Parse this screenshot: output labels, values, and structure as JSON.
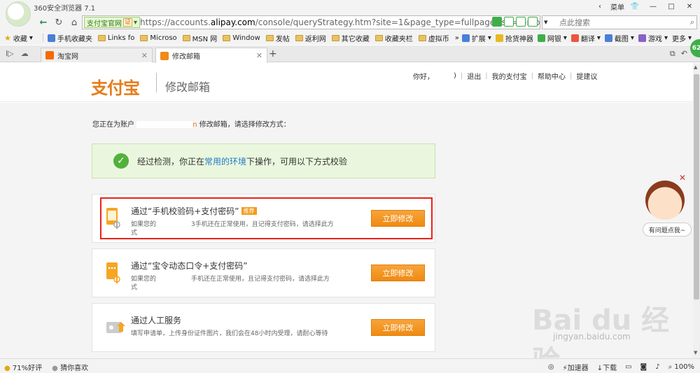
{
  "titlebar": {
    "app_title": "360安全浏览器 7.1",
    "menu_label": "菜单",
    "controls": [
      "‹",
      "菜单",
      "—",
      "□",
      "✕"
    ]
  },
  "addressbar": {
    "cert_label": "支付宝官网",
    "cert_mark": "证",
    "url_prefix": "https://accounts.",
    "url_domain": "alipay.com",
    "url_rest": "/console/queryStrategy.htm?site=1&page_type=fullpage&sp=1-mo",
    "search_placeholder": "点此搜索"
  },
  "bookmarks": {
    "left": [
      "收藏",
      "手机收藏夹",
      "Links fo",
      "Microso",
      "MSN 网",
      "Window",
      "发帖",
      "返利网",
      "其它收藏",
      "收藏夹栏",
      "虚拟币"
    ],
    "right": [
      "扩展",
      "抢货神器",
      "网银",
      "翻译",
      "截图",
      "游戏",
      "更多"
    ]
  },
  "tabs": [
    {
      "label": "淘宝网",
      "active": false
    },
    {
      "label": "修改邮箱",
      "active": true
    }
  ],
  "green_bubble": "62",
  "header": {
    "logo_text": "支付宝",
    "page_title": "修改邮箱",
    "nav": [
      "你好，",
      "退出",
      "我的支付宝",
      "帮助中心",
      "提建议"
    ]
  },
  "content": {
    "acct_prefix": "您正在为账户",
    "acct_suffix": "修改邮箱，请选择修改方式：",
    "notice_before": "经过检测，你正在",
    "notice_link": "常用的环境",
    "notice_after": "下操作，可用以下方式校验",
    "options": [
      {
        "title": "通过“手机校验码+支付密码”",
        "badge": "推荐",
        "desc_1": "如果您的",
        "desc_2": "3手机还在正常使用，且记得支付密码，请选择此方",
        "desc_3": "式",
        "button": "立即修改"
      },
      {
        "title": "通过“宝令动态口令+支付密码”",
        "desc_1": "如果您的",
        "desc_2": "手机还在正常使用，且记得支付密码，请选择此方",
        "desc_3": "式",
        "button": "立即修改"
      },
      {
        "title": "通过人工服务",
        "desc_1": "填写申请单，上传身份证件图片，我们会在48小时内受理，请耐心等待",
        "button": "立即修改"
      }
    ]
  },
  "chat": {
    "label": "有问题点我~"
  },
  "watermark": {
    "main": "Bai du 经验",
    "sub": "jingyan.baidu.com"
  },
  "statusbar": {
    "rating": "71%好评",
    "guess": "猜你喜欢",
    "accelerator": "加速器",
    "download": "下载",
    "zoom": "100%"
  },
  "colors": {
    "alipay_orange": "#ef8a12",
    "alipay_blue": "#3a6fb0",
    "notice_green": "#52b13b",
    "highlight_red": "#e8211a"
  }
}
